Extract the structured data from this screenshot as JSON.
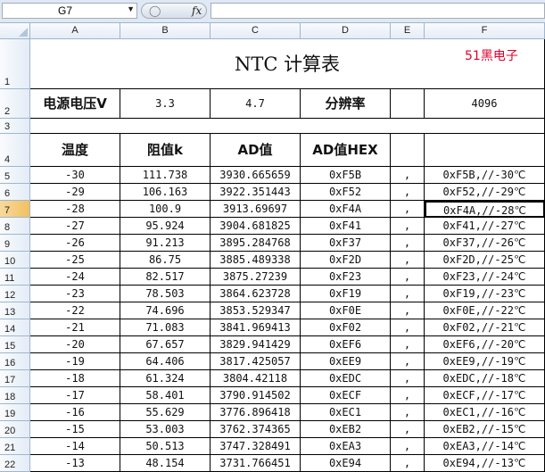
{
  "formula_bar": {
    "name_box": "G7",
    "formula": ""
  },
  "columns": [
    "A",
    "B",
    "C",
    "D",
    "E",
    "F"
  ],
  "selected_column": "G",
  "selected_row": "7",
  "title": "NTC 计算表",
  "watermark": "51黑电子",
  "row2": {
    "vlabel": "电源电压V",
    "v1": "3.3",
    "v2": "4.7",
    "reslabel": "分辨率",
    "res": "4096"
  },
  "headers": {
    "temp": "温度",
    "resistance": "阻值k",
    "ad": "AD值",
    "adhex": "AD值HEX"
  },
  "rows": [
    {
      "n": "5",
      "t": "-30",
      "r": "111.738",
      "ad": "3930.665659",
      "hex": "0xF5B",
      "e": ",",
      "f": "0xF5B,//-30℃"
    },
    {
      "n": "6",
      "t": "-29",
      "r": "106.163",
      "ad": "3922.351443",
      "hex": "0xF52",
      "e": ",",
      "f": "0xF52,//-29℃"
    },
    {
      "n": "7",
      "t": "-28",
      "r": "100.9",
      "ad": "3913.69697",
      "hex": "0xF4A",
      "e": ",",
      "f": "0xF4A,//-28℃"
    },
    {
      "n": "8",
      "t": "-27",
      "r": "95.924",
      "ad": "3904.681825",
      "hex": "0xF41",
      "e": ",",
      "f": "0xF41,//-27℃"
    },
    {
      "n": "9",
      "t": "-26",
      "r": "91.213",
      "ad": "3895.284768",
      "hex": "0xF37",
      "e": ",",
      "f": "0xF37,//-26℃"
    },
    {
      "n": "10",
      "t": "-25",
      "r": "86.75",
      "ad": "3885.489338",
      "hex": "0xF2D",
      "e": ",",
      "f": "0xF2D,//-25℃"
    },
    {
      "n": "11",
      "t": "-24",
      "r": "82.517",
      "ad": "3875.27239",
      "hex": "0xF23",
      "e": ",",
      "f": "0xF23,//-24℃"
    },
    {
      "n": "12",
      "t": "-23",
      "r": "78.503",
      "ad": "3864.623728",
      "hex": "0xF19",
      "e": ",",
      "f": "0xF19,//-23℃"
    },
    {
      "n": "13",
      "t": "-22",
      "r": "74.696",
      "ad": "3853.529347",
      "hex": "0xF0E",
      "e": ",",
      "f": "0xF0E,//-22℃"
    },
    {
      "n": "14",
      "t": "-21",
      "r": "71.083",
      "ad": "3841.969413",
      "hex": "0xF02",
      "e": ",",
      "f": "0xF02,//-21℃"
    },
    {
      "n": "15",
      "t": "-20",
      "r": "67.657",
      "ad": "3829.941429",
      "hex": "0xEF6",
      "e": ",",
      "f": "0xEF6,//-20℃"
    },
    {
      "n": "16",
      "t": "-19",
      "r": "64.406",
      "ad": "3817.425057",
      "hex": "0xEE9",
      "e": ",",
      "f": "0xEE9,//-19℃"
    },
    {
      "n": "17",
      "t": "-18",
      "r": "61.324",
      "ad": "3804.42118",
      "hex": "0xEDC",
      "e": ",",
      "f": "0xEDC,//-18℃"
    },
    {
      "n": "18",
      "t": "-17",
      "r": "58.401",
      "ad": "3790.914502",
      "hex": "0xECF",
      "e": ",",
      "f": "0xECF,//-17℃"
    },
    {
      "n": "19",
      "t": "-16",
      "r": "55.629",
      "ad": "3776.896418",
      "hex": "0xEC1",
      "e": ",",
      "f": "0xEC1,//-16℃"
    },
    {
      "n": "20",
      "t": "-15",
      "r": "53.003",
      "ad": "3762.374365",
      "hex": "0xEB2",
      "e": ",",
      "f": "0xEB2,//-15℃"
    },
    {
      "n": "21",
      "t": "-14",
      "r": "50.513",
      "ad": "3747.328491",
      "hex": "0xEA3",
      "e": ",",
      "f": "0xEA3,//-14℃"
    },
    {
      "n": "22",
      "t": "-13",
      "r": "48.154",
      "ad": "3731.766451",
      "hex": "0xE94",
      "e": ",",
      "f": "0xE94,//-13℃"
    }
  ],
  "colors": {
    "header_bg": "#e4ecf7",
    "selected_header": "#f1c15f",
    "watermark": "#e0002a"
  }
}
